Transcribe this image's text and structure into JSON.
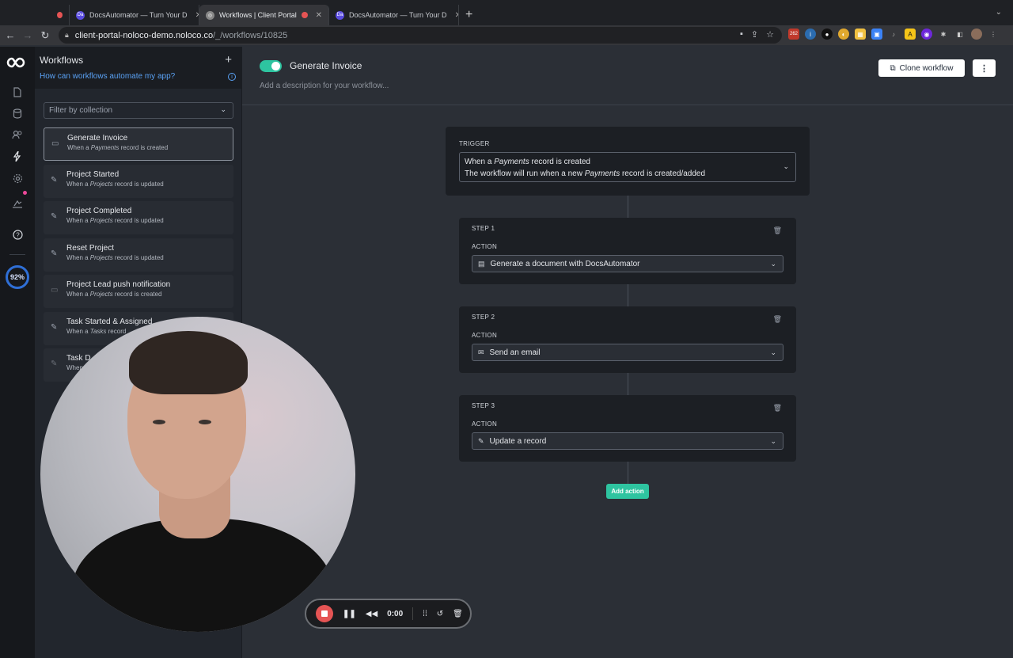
{
  "browser": {
    "tabs": [
      {
        "label": "",
        "recording": true
      },
      {
        "label": "DocsAutomator — Turn Your D",
        "fav": "Da"
      },
      {
        "label": "Workflows | Client Portal",
        "active": true
      },
      {
        "label": "DocsAutomator — Turn Your D",
        "fav": "Da"
      }
    ],
    "url_host": "client-portal-noloco-demo.noloco.co",
    "url_path": "/_/workflows/10825",
    "ext_badge": "262"
  },
  "rail": {
    "percent": "92%"
  },
  "sidebar": {
    "title": "Workflows",
    "help_link": "How can workflows automate my app?",
    "filter_placeholder": "Filter by collection",
    "items": [
      {
        "name": "Generate Invoice",
        "sub_pre": "When a ",
        "sub_coll": "Payments",
        "sub_post": " record is created"
      },
      {
        "name": "Project Started",
        "sub_pre": "When a ",
        "sub_coll": "Projects",
        "sub_post": " record is updated"
      },
      {
        "name": "Project Completed",
        "sub_pre": "When a ",
        "sub_coll": "Projects",
        "sub_post": " record is updated"
      },
      {
        "name": "Reset Project",
        "sub_pre": "When a ",
        "sub_coll": "Projects",
        "sub_post": " record is updated"
      },
      {
        "name": "Project Lead push notification",
        "sub_pre": "When a ",
        "sub_coll": "Projects",
        "sub_post": " record is created"
      },
      {
        "name": "Task Started & Assigned",
        "sub_pre": "When a ",
        "sub_coll": "Tasks",
        "sub_post": " record"
      },
      {
        "name": "Task D",
        "sub_pre": "When",
        "sub_coll": "",
        "sub_post": ""
      }
    ]
  },
  "main": {
    "workflow_title": "Generate Invoice",
    "description_placeholder": "Add a description for your workflow...",
    "clone_label": "Clone workflow",
    "more_label": "⋮",
    "trigger": {
      "label": "TRIGGER",
      "line1_pre": "When a ",
      "line1_coll": "Payments",
      "line1_post": " record is created",
      "line2_pre": "The workflow will run when a new ",
      "line2_coll": "Payments",
      "line2_post": " record is created/added"
    },
    "steps": [
      {
        "step_label": "STEP 1",
        "action_label": "ACTION",
        "action": "Generate a document with DocsAutomator",
        "icon": "document-icon"
      },
      {
        "step_label": "STEP 2",
        "action_label": "ACTION",
        "action": "Send an email",
        "icon": "mail-icon"
      },
      {
        "step_label": "STEP 3",
        "action_label": "ACTION",
        "action": "Update a record",
        "icon": "edit-icon"
      }
    ],
    "add_action_label": "Add action"
  },
  "recorder": {
    "time": "0:00"
  }
}
